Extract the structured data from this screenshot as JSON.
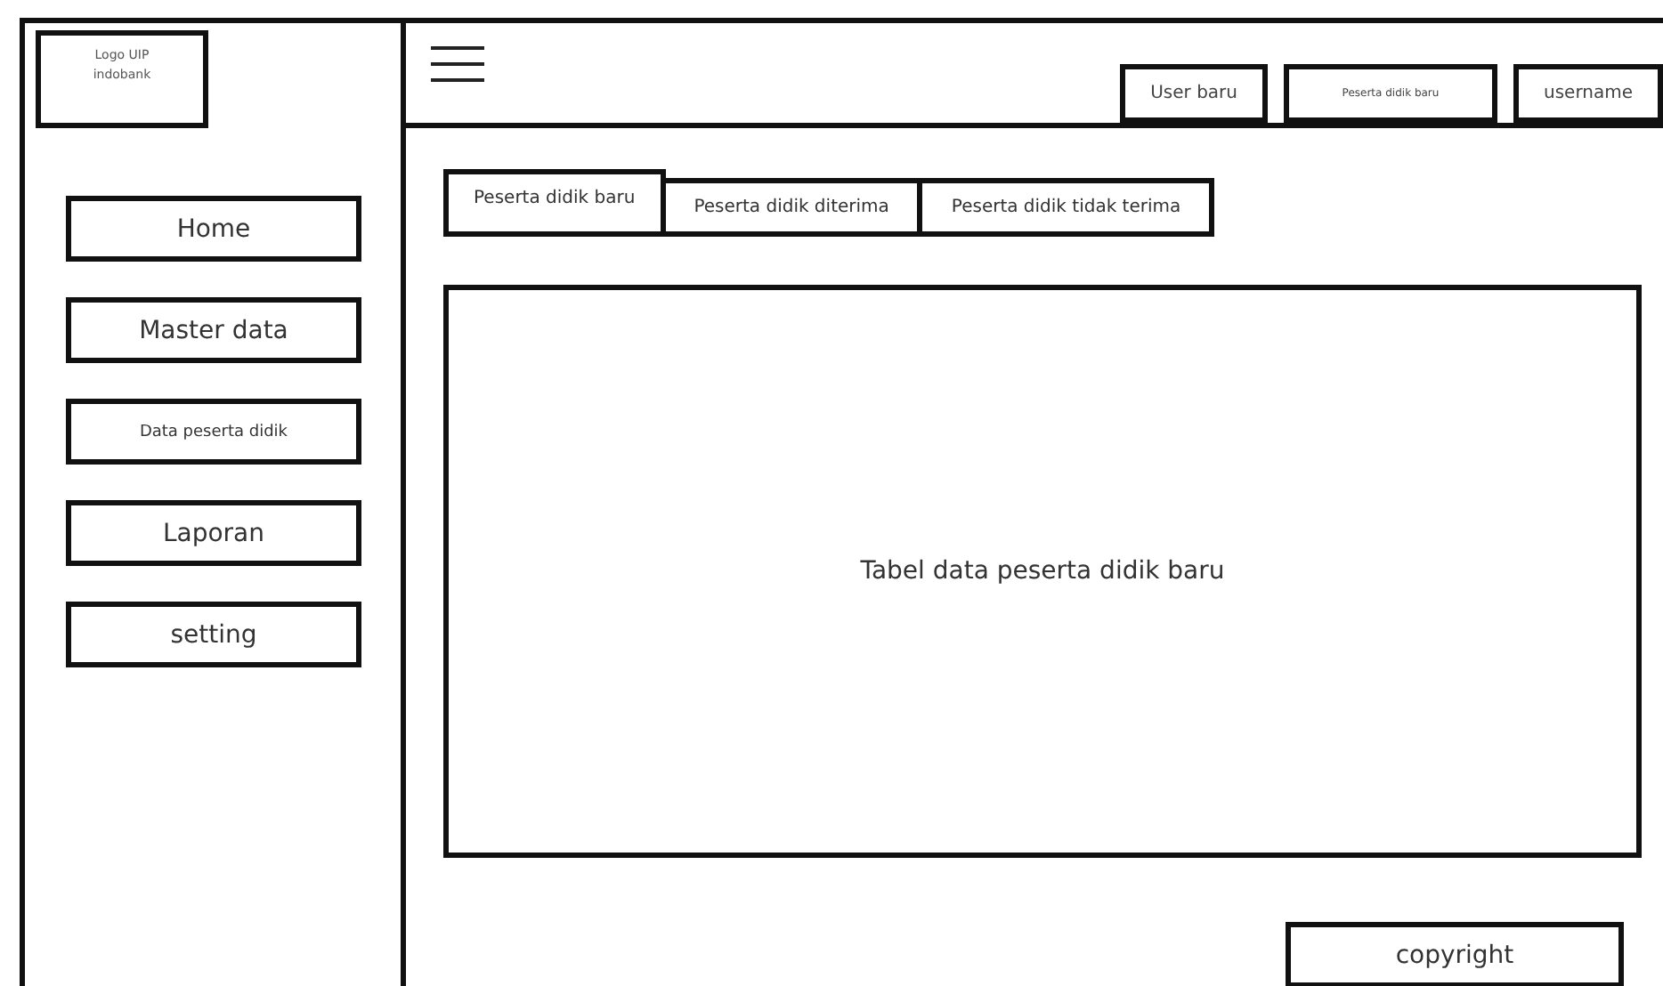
{
  "logo": {
    "lines": [
      "Logo UIP",
      "indobank"
    ]
  },
  "sidebar": {
    "items": [
      {
        "label": "Home",
        "kind": "normal"
      },
      {
        "label": "Master data",
        "kind": "normal"
      },
      {
        "label": "Data peserta didik",
        "kind": "small"
      },
      {
        "label": "Laporan",
        "kind": "normal"
      },
      {
        "label": "setting",
        "kind": "normal"
      }
    ]
  },
  "header": {
    "buttons": [
      {
        "label": "User baru",
        "kind": "normal"
      },
      {
        "label": "Peserta didik baru",
        "kind": "tiny"
      },
      {
        "label": "username",
        "kind": "normal"
      }
    ]
  },
  "tabs": [
    {
      "label": "Peserta didik baru",
      "selected": true
    },
    {
      "label": "Peserta didik diterima",
      "selected": false
    },
    {
      "label": "Peserta didik tidak terima",
      "selected": false
    }
  ],
  "table": {
    "placeholder": "Tabel data peserta didik baru"
  },
  "footer": {
    "copyright": "copyright"
  }
}
